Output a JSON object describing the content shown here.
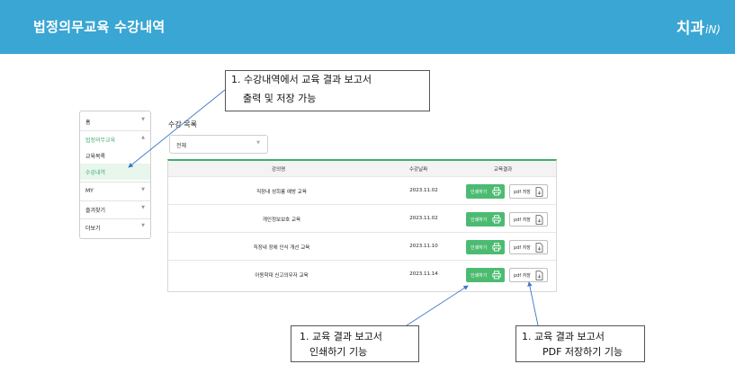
{
  "header": {
    "title": "법정의무교육 수강내역",
    "logo_main": "치과",
    "logo_sub": "iN)"
  },
  "sidebar": {
    "items": [
      {
        "label": "홈",
        "chevron": "▼"
      },
      {
        "label": "법정의무교육",
        "chevron": "▲"
      },
      {
        "label": "교육목록",
        "chevron": ""
      },
      {
        "label": "수강내역",
        "chevron": ""
      },
      {
        "label": "MY",
        "chevron": "▼"
      },
      {
        "label": "즐겨찾기",
        "chevron": "▼"
      },
      {
        "label": "더보기",
        "chevron": "▼"
      }
    ]
  },
  "main": {
    "section_title": "수강 목록",
    "filter": {
      "value": "전체",
      "chevron": "▼"
    },
    "table": {
      "headers": [
        "강의명",
        "수강날짜",
        "교육결과"
      ],
      "rows": [
        {
          "course": "직장내 성희롱 예방 교육",
          "date": "2023.11.02",
          "print_label": "인쇄하기",
          "pdf_label": "pdf 저장"
        },
        {
          "course": "개인정보보호 교육",
          "date": "2023.11.02",
          "print_label": "인쇄하기",
          "pdf_label": "pdf 저장"
        },
        {
          "course": "직장내 장애 인식 개선 교육",
          "date": "2023.11.10",
          "print_label": "인쇄하기",
          "pdf_label": "pdf 저장"
        },
        {
          "course": "아동학대 신고의무자 교육",
          "date": "2023.11.14",
          "print_label": "인쇄하기",
          "pdf_label": "pdf 저장"
        }
      ]
    }
  },
  "annotations": {
    "note1": {
      "line1": "1. 수강내역에서 교육 결과 보고서",
      "line2": "출력 및 저장 가능"
    },
    "note2": {
      "line1": "1. 교육 결과 보고서",
      "line2": "인쇄하기 기능"
    },
    "note3": {
      "line1": "1. 교육 결과 보고서",
      "line2": "PDF 저장하기 기능"
    }
  },
  "colors": {
    "header_bg": "#3aa6d4",
    "accent_green": "#4cbb72",
    "annotation_line": "#3b78c8"
  },
  "icons": {
    "print": "printer-icon",
    "pdf": "document-icon"
  }
}
